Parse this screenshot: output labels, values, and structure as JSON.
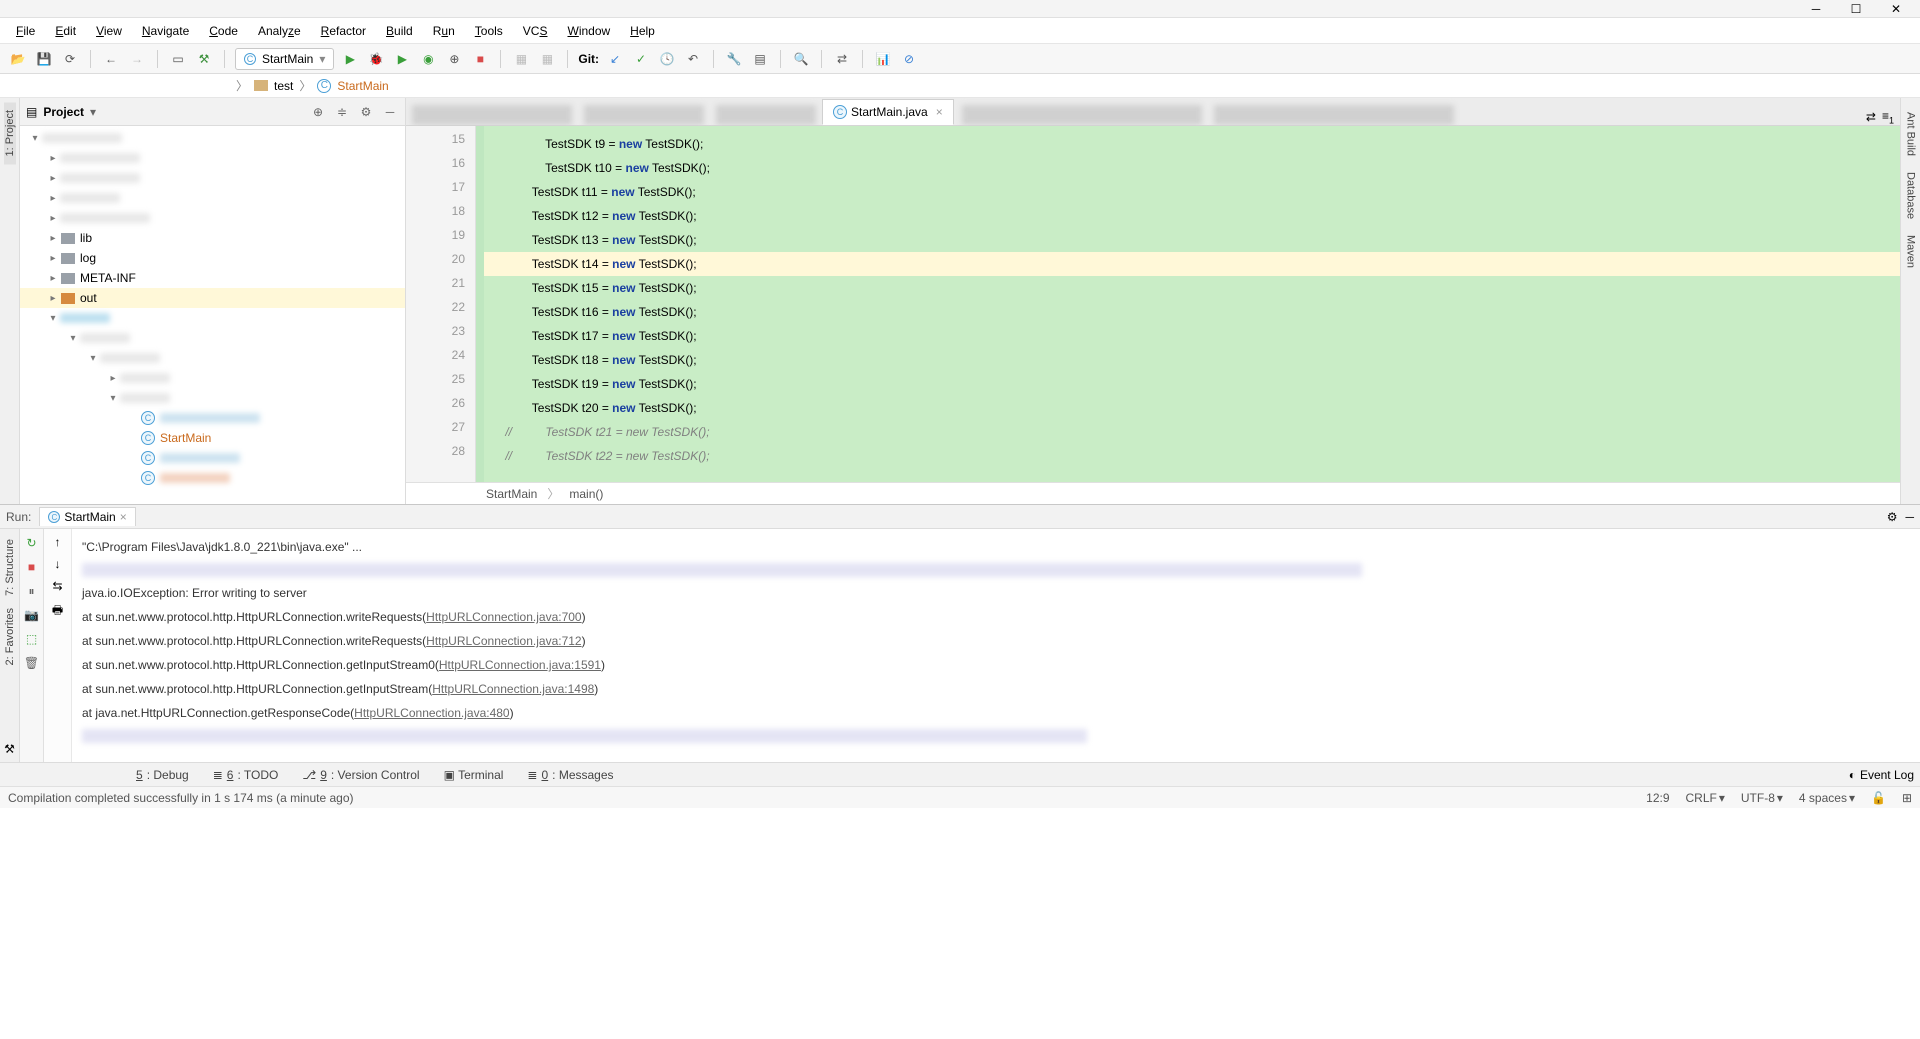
{
  "menu": {
    "file": "File",
    "edit": "Edit",
    "view": "View",
    "navigate": "Navigate",
    "code": "Code",
    "analyze": "Analyze",
    "refactor": "Refactor",
    "build": "Build",
    "run": "Run",
    "tools": "Tools",
    "vcs": "VCS",
    "window": "Window",
    "help": "Help"
  },
  "runConfig": "StartMain",
  "gitLabel": "Git:",
  "breadcrumb": {
    "folder": "test",
    "cls": "StartMain"
  },
  "projectPanel": {
    "title": "Project"
  },
  "leftTabs": {
    "project": "1: Project"
  },
  "leftTabs2": {
    "structure": "7: Structure",
    "favorites": "2: Favorites"
  },
  "rightTabs": {
    "ant": "Ant Build",
    "database": "Database",
    "maven": "Maven"
  },
  "tree": {
    "lib": "lib",
    "log": "log",
    "meta": "META-INF",
    "out": "out",
    "startmain": "StartMain"
  },
  "editorTab": "StartMain.java",
  "code": {
    "lines": [
      {
        "n": 15,
        "pre": "                TestSDK t9 = ",
        "kw": "new",
        "post": " TestSDK();"
      },
      {
        "n": 16,
        "pre": "                TestSDK t10 = ",
        "kw": "new",
        "post": " TestSDK();"
      },
      {
        "n": 17,
        "pre": "            TestSDK t11 = ",
        "kw": "new",
        "post": " TestSDK();"
      },
      {
        "n": 18,
        "pre": "            TestSDK t12 = ",
        "kw": "new",
        "post": " TestSDK();"
      },
      {
        "n": 19,
        "pre": "            TestSDK t13 = ",
        "kw": "new",
        "post": " TestSDK();"
      },
      {
        "n": 20,
        "pre": "            TestSDK t14 = ",
        "kw": "new",
        "post": " TestSDK();",
        "current": true
      },
      {
        "n": 21,
        "pre": "            TestSDK t15 = ",
        "kw": "new",
        "post": " TestSDK();"
      },
      {
        "n": 22,
        "pre": "            TestSDK t16 = ",
        "kw": "new",
        "post": " TestSDK();"
      },
      {
        "n": 23,
        "pre": "            TestSDK t17 = ",
        "kw": "new",
        "post": " TestSDK();"
      },
      {
        "n": 24,
        "pre": "            TestSDK t18 = ",
        "kw": "new",
        "post": " TestSDK();"
      },
      {
        "n": 25,
        "pre": "            TestSDK t19 = ",
        "kw": "new",
        "post": " TestSDK();"
      },
      {
        "n": 26,
        "pre": "            TestSDK t20 = ",
        "kw": "new",
        "post": " TestSDK();"
      },
      {
        "n": 27,
        "comment": "//          TestSDK t21 = new TestSDK();"
      },
      {
        "n": 28,
        "comment": "//          TestSDK t22 = new TestSDK();"
      }
    ],
    "crumb1": "StartMain",
    "crumb2": "main()"
  },
  "runPanel": {
    "label": "Run:",
    "tab": "StartMain"
  },
  "console": {
    "cmd": "\"C:\\Program Files\\Java\\jdk1.8.0_221\\bin\\java.exe\" ...",
    "ex": "java.io.IOException: Error writing to server",
    "l1a": "    at sun.net.www.protocol.http.HttpURLConnection.writeRequests(",
    "l1b": "HttpURLConnection.java:700",
    "l1c": ")",
    "l2a": "    at sun.net.www.protocol.http.HttpURLConnection.writeRequests(",
    "l2b": "HttpURLConnection.java:712",
    "l2c": ")",
    "l3a": "    at sun.net.www.protocol.http.HttpURLConnection.getInputStream0(",
    "l3b": "HttpURLConnection.java:1591",
    "l3c": ")",
    "l4a": "    at sun.net.www.protocol.http.HttpURLConnection.getInputStream(",
    "l4b": "HttpURLConnection.java:1498",
    "l4c": ")",
    "l5a": "    at java.net.HttpURLConnection.getResponseCode(",
    "l5b": "HttpURLConnection.java:480",
    "l5c": ")"
  },
  "bottomTabs": {
    "debug": "5: Debug",
    "todo": "6: TODO",
    "vc": "9: Version Control",
    "terminal": "Terminal",
    "messages": "0: Messages",
    "eventlog": "Event Log"
  },
  "status": {
    "msg": "Compilation completed successfully in 1 s 174 ms (a minute ago)",
    "pos": "12:9",
    "le": "CRLF",
    "enc": "UTF-8",
    "indent": "4 spaces"
  }
}
